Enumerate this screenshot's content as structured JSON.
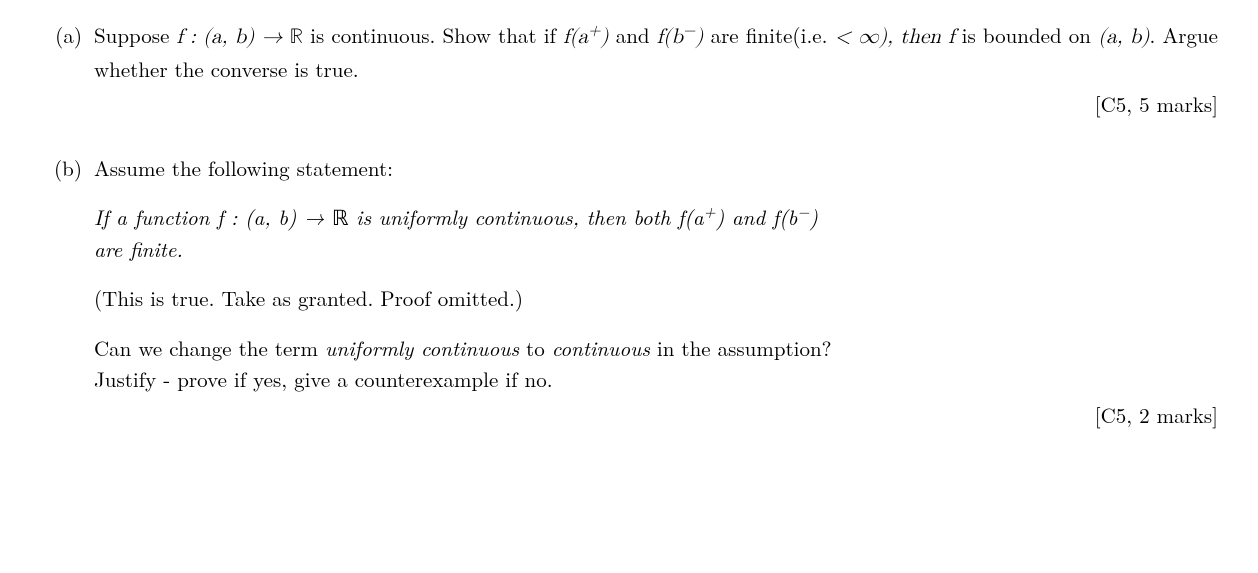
{
  "parts": {
    "a": {
      "label": "(a)",
      "line1_pre": "Suppose ",
      "line1_math1": "f : (a, b) → ",
      "line1_R": "ℝ",
      "line1_mid": " is continuous. Show that if ",
      "line1_fa": "f(a",
      "line1_fa_sup": "+",
      "line1_fa_close": ")",
      "line1_and": " and ",
      "line1_fb": "f(b",
      "line1_fb_sup": "−",
      "line1_fb_close": ")",
      "line1_end": " are finite(i.e.",
      "line2_pre": "< ∞), then ",
      "line2_f": "f",
      "line2_mid": " is bounded on ",
      "line2_ab": "(a, b)",
      "line2_end": ". Argue whether the converse is true.",
      "marks": "[C5, 5 marks]"
    },
    "b": {
      "label": "(b)",
      "intro": "Assume the following statement:",
      "stmt_pre": "If a function ",
      "stmt_f": "f : (a, b) → ",
      "stmt_R": "ℝ",
      "stmt_mid": " is uniformly continuous, then both ",
      "stmt_fa": "f(a",
      "stmt_fa_sup": "+",
      "stmt_fa_close": ")",
      "stmt_and": " and ",
      "stmt_fb": "f(b",
      "stmt_fb_sup": "−",
      "stmt_fb_close": ")",
      "stmt_line2": "are finite.",
      "granted": "(This is true. Take as granted. Proof omitted.)",
      "q_pre": "Can we change the term ",
      "q_uc": "uniformly continuous",
      "q_mid": " to ",
      "q_c": "continuous",
      "q_end": " in the assumption?",
      "q_line2": "Justify - prove if yes, give a counterexample if no.",
      "marks": "[C5, 2 marks]"
    }
  }
}
